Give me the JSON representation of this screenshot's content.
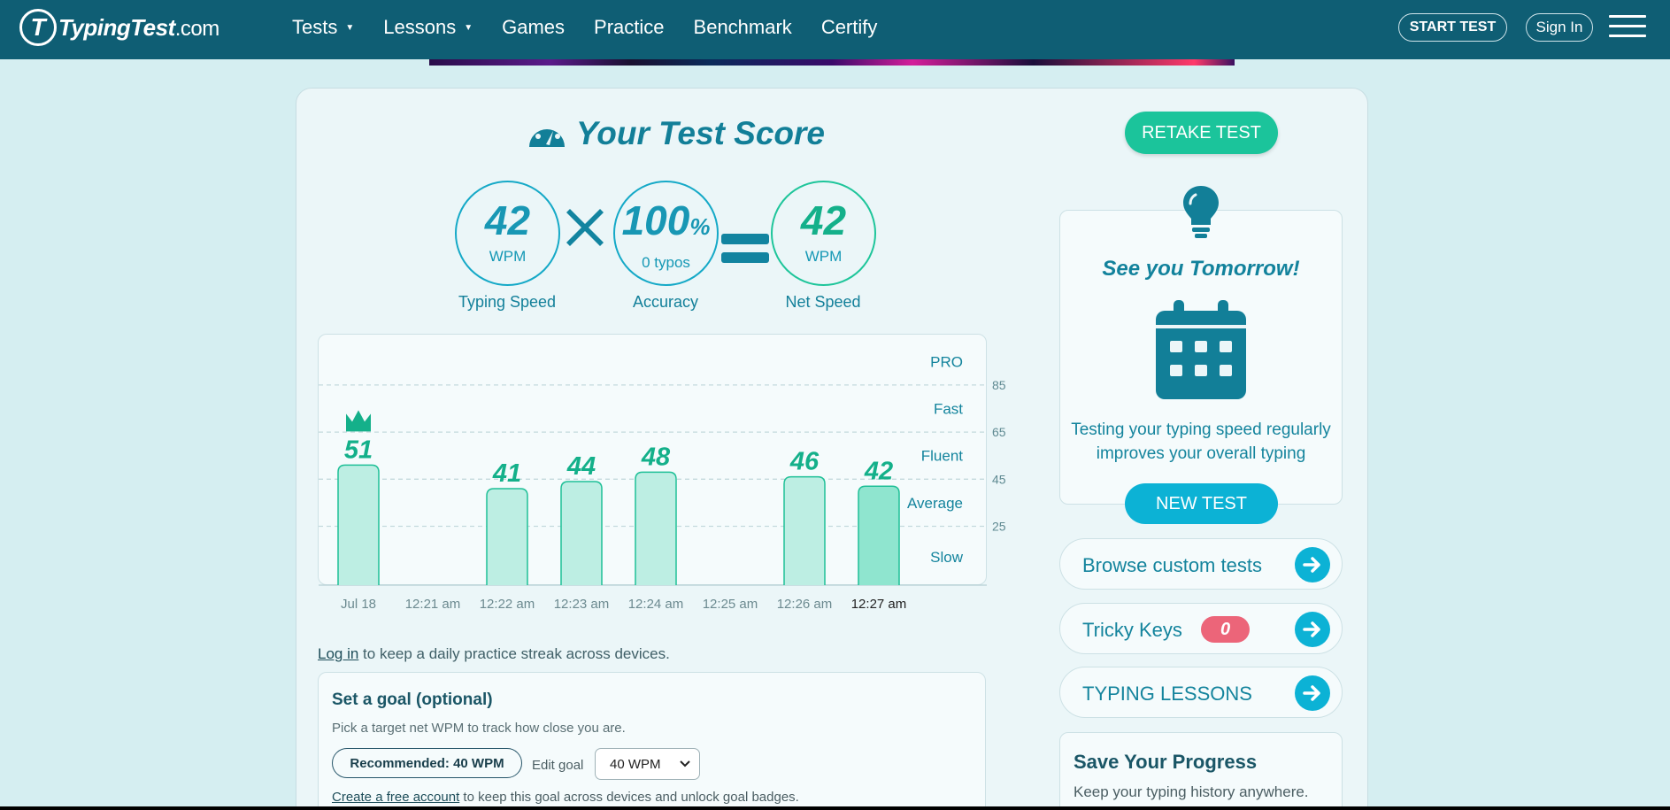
{
  "nav": {
    "logo_text": "TypingTest",
    "logo_domain": ".com",
    "logo_mark": "T",
    "items": [
      {
        "label": "Tests",
        "dropdown": true
      },
      {
        "label": "Lessons",
        "dropdown": true
      },
      {
        "label": "Games",
        "dropdown": false
      },
      {
        "label": "Practice",
        "dropdown": false
      },
      {
        "label": "Benchmark",
        "dropdown": false
      },
      {
        "label": "Certify",
        "dropdown": false
      }
    ],
    "start_test": "START TEST",
    "sign_in": "Sign In",
    "menu_icon": "hamburger-icon"
  },
  "score": {
    "title": "Your Test Score",
    "title_icon": "gauge-icon",
    "typing_speed": {
      "value": "42",
      "unit": "WPM",
      "label": "Typing Speed"
    },
    "accuracy": {
      "value": "100",
      "suffix": "%",
      "sub": "0 typos",
      "label": "Accuracy"
    },
    "net_speed": {
      "value": "42",
      "unit": "WPM",
      "label": "Net Speed"
    },
    "multiply_icon": "multiply-icon",
    "equals_icon": "equals-icon"
  },
  "chart_data": {
    "type": "bar",
    "categories": [
      "Jul 18",
      "12:21 am",
      "12:22 am",
      "12:23 am",
      "12:24 am",
      "12:25 am",
      "12:26 am",
      "12:27 am"
    ],
    "values": [
      51,
      null,
      41,
      44,
      48,
      null,
      46,
      42
    ],
    "data_labels": [
      "51",
      "",
      "41",
      "44",
      "48",
      "",
      "46",
      "42"
    ],
    "best_index": 0,
    "best_icon": "crown-icon",
    "current_index": 7,
    "ylim": [
      0,
      105
    ],
    "gridlines": [
      25,
      45,
      65,
      85
    ],
    "gridline_labels": [
      "25",
      "45",
      "65",
      "85"
    ],
    "speed_bands": [
      {
        "label": "PRO",
        "value": 95
      },
      {
        "label": "Fast",
        "value": 75
      },
      {
        "label": "Fluent",
        "value": 55
      },
      {
        "label": "Average",
        "value": 35
      },
      {
        "label": "Slow",
        "value": 12
      }
    ],
    "colors": {
      "bar": "#bdeee3",
      "bar_current": "#8fe5cf",
      "bar_stroke": "#1fc097",
      "label": "#14b08a",
      "grid": "#c4dadd"
    }
  },
  "login_prompt": {
    "link": "Log in",
    "text": " to keep a daily practice streak across devices."
  },
  "goal": {
    "title": "Set a goal (optional)",
    "subtitle": "Pick a target net WPM to track how close you are.",
    "recommended": "Recommended: 40 WPM",
    "edit_label": "Edit goal",
    "selected": "40 WPM",
    "create_link": "Create a free account",
    "create_text": " to keep this goal across devices and unlock goal badges."
  },
  "side": {
    "retake": "RETAKE TEST",
    "tomorrow_title": "See you Tomorrow!",
    "tomorrow_text": "Testing your typing speed regularly improves your overall typing",
    "new_test": "NEW TEST",
    "links": [
      {
        "label": "Browse custom tests"
      },
      {
        "label": "Tricky Keys",
        "badge": "0"
      },
      {
        "label": "TYPING LESSONS"
      }
    ],
    "save_title": "Save Your Progress",
    "save_sub": "Keep your typing history anywhere."
  }
}
